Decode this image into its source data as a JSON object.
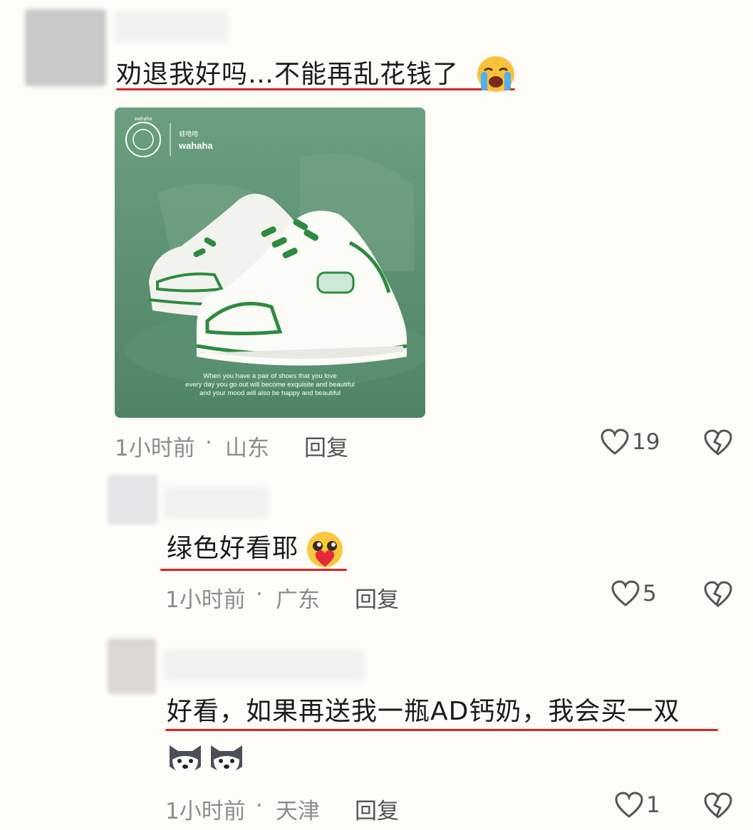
{
  "comments": [
    {
      "text": "劝退我好吗…不能再乱花钱了",
      "emoji": "loudly-crying-face",
      "time": "1小时前",
      "location": "山东",
      "separator": "·",
      "reply_label": "回复",
      "likes": "19",
      "image": {
        "brand_name": "wahaha",
        "brand_badge": "wahaha",
        "brand_cn": "娃哈哈",
        "tagline_lines": [
          "When you have a pair of shoes that you love",
          "every day you go out will become exquisite and beautiful",
          "and your mood will also be happy and beautiful"
        ]
      }
    },
    {
      "text": "绿色好看耶",
      "emoji": "pleading-face-with-heart",
      "time": "1小时前",
      "location": "广东",
      "separator": "·",
      "reply_label": "回复",
      "likes": "5"
    },
    {
      "text": "好看，如果再送我一瓶AD钙奶，我会买一双",
      "emoji": "husky-dog-face",
      "time": "1小时前",
      "location": "天津",
      "separator": "·",
      "reply_label": "回复",
      "likes": "1"
    }
  ],
  "colors": {
    "underline": "#d22222",
    "product_bg": "#5e9474",
    "accent_green": "#2e8b3e"
  }
}
